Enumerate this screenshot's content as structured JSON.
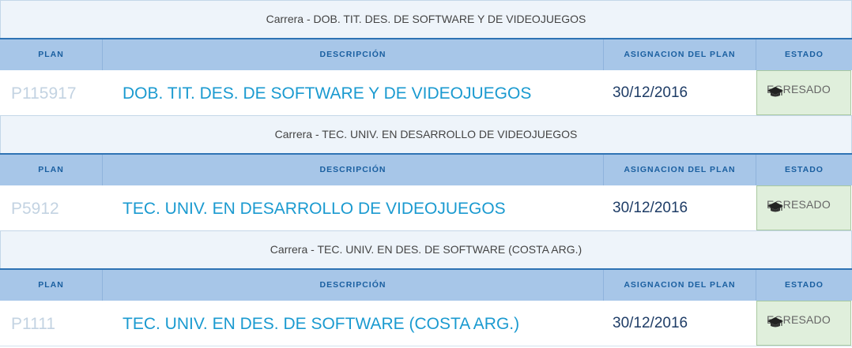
{
  "header_labels": {
    "plan": "PLAN",
    "descripcion": "DESCRIPCIÓN",
    "asignacion": "ASIGNACION DEL PLAN",
    "estado": "ESTADO"
  },
  "careers": [
    {
      "title": "Carrera - DOB. TIT. DES. DE SOFTWARE Y DE VIDEOJUEGOS",
      "plan": "P115917",
      "descripcion": "DOB. TIT. DES. DE SOFTWARE Y DE VIDEOJUEGOS",
      "asignacion": "30/12/2016",
      "estado": "EGRESADO",
      "estado_icon": "graduation-cap-icon"
    },
    {
      "title": "Carrera - TEC. UNIV. EN DESARROLLO DE VIDEOJUEGOS",
      "plan": "P5912",
      "descripcion": "TEC. UNIV. EN DESARROLLO DE VIDEOJUEGOS",
      "asignacion": "30/12/2016",
      "estado": "EGRESADO",
      "estado_icon": "graduation-cap-icon"
    },
    {
      "title": "Carrera - TEC. UNIV. EN DES. DE SOFTWARE (COSTA ARG.)",
      "plan": "P1111",
      "descripcion": "TEC. UNIV. EN DES. DE SOFTWARE (COSTA ARG.)",
      "asignacion": "30/12/2016",
      "estado": "EGRESADO",
      "estado_icon": "graduation-cap-icon"
    }
  ],
  "colors": {
    "header_bg": "#a7c6e8",
    "header_text": "#1a5fa0",
    "description_text": "#1a9ad0",
    "status_bg": "#e0efdc"
  }
}
